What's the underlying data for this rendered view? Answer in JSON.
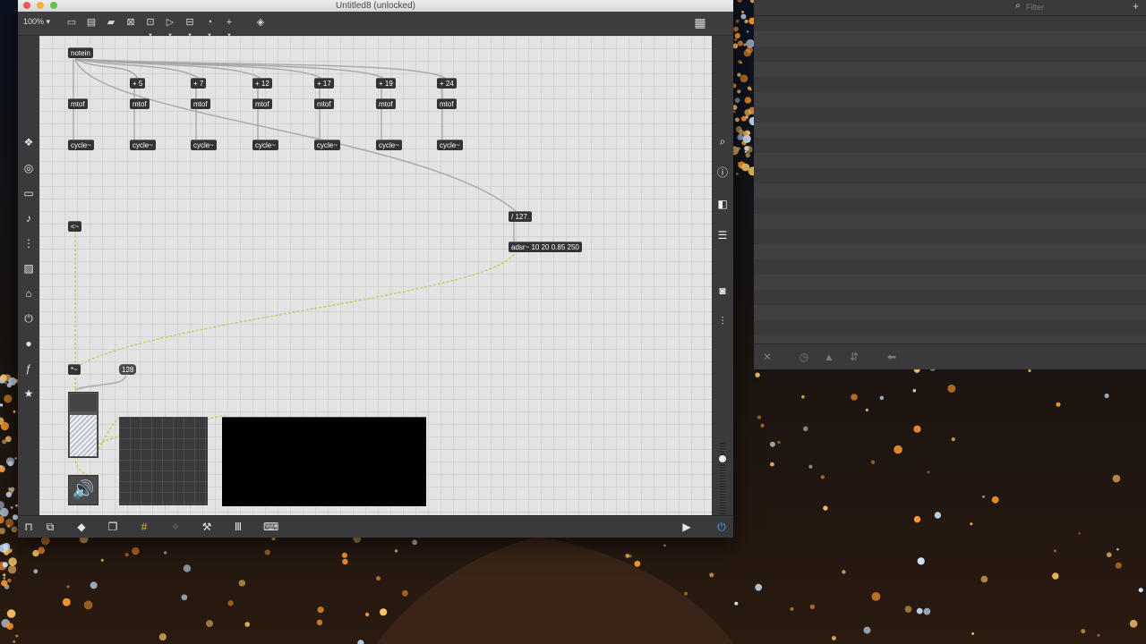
{
  "window": {
    "title": "Untitled8 (unlocked)",
    "zoom": "100%"
  },
  "colors": {
    "patch_bg": "#e3e3e4",
    "object_bg": "#333335",
    "signal_wire": "#c9c95a",
    "control_wire": "#a7a7a7",
    "console_bg": "#3c3c3e"
  },
  "toolbar_icons": [
    "new-object-icon",
    "message-icon",
    "comment-icon",
    "button-icon",
    "toggle-icon",
    "number-icon",
    "slider-icon",
    "dial-icon",
    "add-icon",
    "paint-bucket-icon",
    "grid-icon"
  ],
  "left_sidebar_icons": [
    "package-icon",
    "target-icon",
    "keyboard-icon",
    "music-note-icon",
    "sequencer-icon",
    "image-icon",
    "tag-icon",
    "plug-icon",
    "vizzie-icon",
    "fx-icon",
    "star-icon"
  ],
  "right_sidebar_icons": [
    "search-icon",
    "info-icon",
    "columns-icon",
    "list-icon",
    "camera-icon",
    "mixer-icon"
  ],
  "objects": {
    "notein": "notein",
    "add5": "+ 5",
    "add7": "+ 7",
    "add12": "+ 12",
    "add17": "+ 17",
    "add19": "+ 19",
    "add24": "+ 24",
    "mtof": "mtof",
    "cycle": "cycle~",
    "divide": "/ 127.",
    "adsr": "adsr~ 10 20 0.85 250",
    "times": "*~",
    "arrow": "<~",
    "msg128": "128"
  },
  "console": {
    "filter_placeholder": "Filter"
  }
}
